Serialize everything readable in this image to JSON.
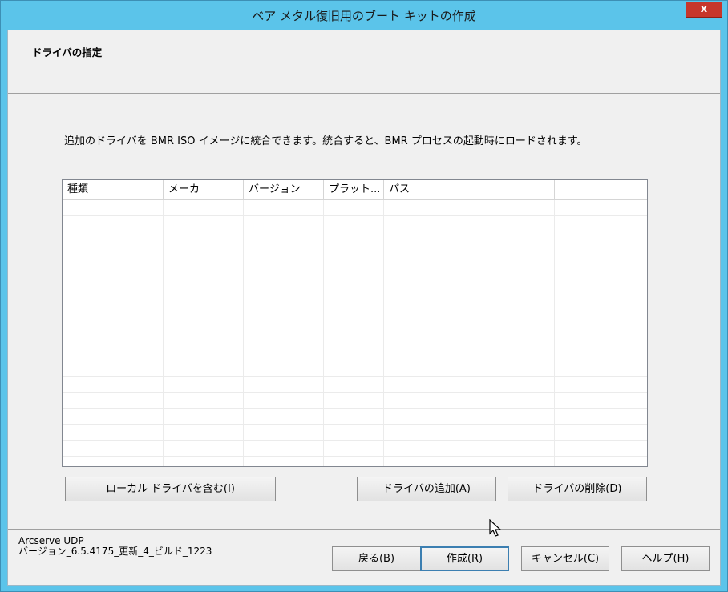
{
  "window": {
    "title": "ベア メタル復旧用のブート キットの作成",
    "close_label": "x"
  },
  "page": {
    "heading": "ドライバの指定",
    "description": "追加のドライバを BMR ISO イメージに統合できます。統合すると、BMR プロセスの起動時にロードされます。"
  },
  "driver_table": {
    "columns": [
      "種類",
      "メーカ",
      "バージョン",
      "プラット...",
      "パス",
      ""
    ],
    "rows": []
  },
  "buttons": {
    "include_local": "ローカル ドライバを含む(I)",
    "add_driver": "ドライバの追加(A)",
    "remove_driver": "ドライバの削除(D)",
    "back": "戻る(B)",
    "create": "作成(R)",
    "cancel": "キャンセル(C)",
    "help": "ヘルプ(H)"
  },
  "footer": {
    "product_name": "Arcserve UDP",
    "version": "バージョン_6.5.4175_更新_4_ビルド_1223"
  },
  "colors": {
    "titlebar": "#5bc4ea",
    "close_button": "#c7362b",
    "dialog_background": "#f0f0f0",
    "default_button_border": "#3c7fb1"
  }
}
